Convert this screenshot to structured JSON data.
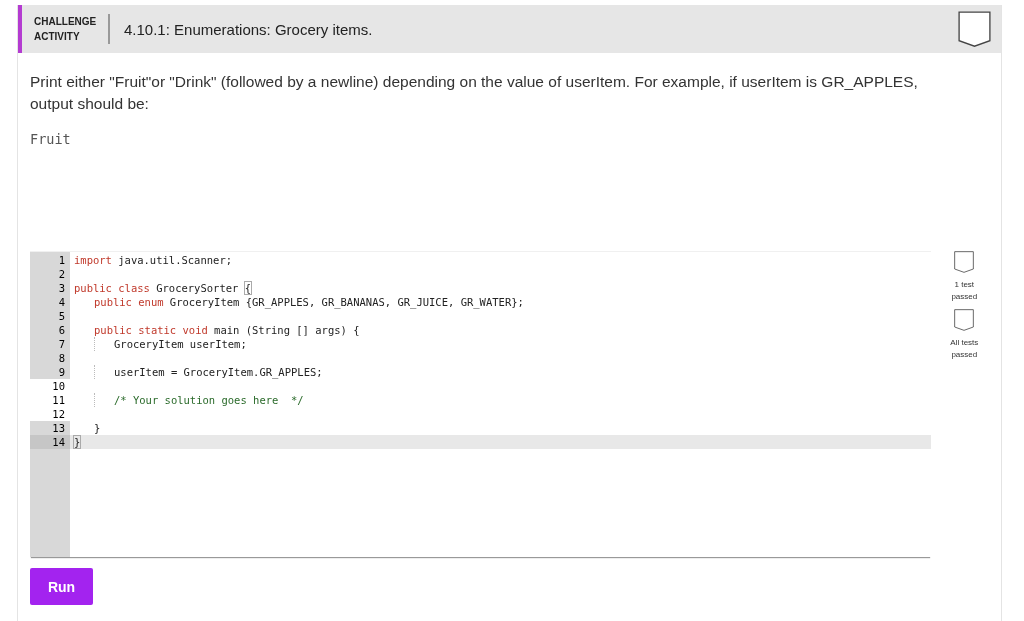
{
  "header": {
    "type_label": "CHALLENGE ACTIVITY",
    "title": "4.10.1: Enumerations: Grocery items.",
    "completed": false
  },
  "prompt": "Print either \"Fruit\"or \"Drink\" (followed by a newline) depending on the value of userItem. For example, if userItem is GR_APPLES, output should be:",
  "sample_output": "Fruit",
  "editor": {
    "lines": [
      {
        "number": "1",
        "kind": "top",
        "shaded": true,
        "current": false,
        "tokens": [
          {
            "kind": "keyword",
            "text": "import"
          },
          {
            "kind": "plain",
            "text": " java.util.Scanner;"
          }
        ]
      },
      {
        "number": "2",
        "kind": "blank",
        "shaded": true,
        "current": false
      },
      {
        "number": "3",
        "kind": "top",
        "shaded": true,
        "current": false,
        "tokens": [
          {
            "kind": "keyword",
            "text": "public class"
          },
          {
            "kind": "plain",
            "text": " GrocerySorter "
          },
          {
            "kind": "bracket",
            "text": "{"
          }
        ]
      },
      {
        "number": "4",
        "kind": "member",
        "shaded": true,
        "current": false,
        "tokens": [
          {
            "kind": "keyword",
            "text": "public enum"
          },
          {
            "kind": "plain",
            "text": " GroceryItem {GR_APPLES, GR_BANANAS, GR_JUICE, GR_WATER};"
          }
        ]
      },
      {
        "number": "5",
        "kind": "blank",
        "shaded": true,
        "current": false
      },
      {
        "number": "6",
        "kind": "member",
        "shaded": true,
        "current": false,
        "tokens": [
          {
            "kind": "keyword",
            "text": "public static void"
          },
          {
            "kind": "plain",
            "text": " main (String [] args) {"
          }
        ]
      },
      {
        "number": "7",
        "kind": "body",
        "shaded": true,
        "current": false,
        "tokens": [
          {
            "kind": "plain",
            "text": "GroceryItem userItem;"
          }
        ]
      },
      {
        "number": "8",
        "kind": "blank",
        "shaded": true,
        "current": false
      },
      {
        "number": "9",
        "kind": "body",
        "shaded": true,
        "current": false,
        "tokens": [
          {
            "kind": "plain",
            "text": "userItem = GroceryItem.GR_APPLES;"
          }
        ]
      },
      {
        "number": "10",
        "kind": "blank",
        "shaded": false,
        "current": false
      },
      {
        "number": "11",
        "kind": "body",
        "shaded": false,
        "current": false,
        "tokens": [
          {
            "kind": "comment",
            "text": "/* Your solution goes here  */"
          }
        ]
      },
      {
        "number": "12",
        "kind": "blank",
        "shaded": false,
        "current": false
      },
      {
        "number": "13",
        "kind": "member",
        "shaded": true,
        "current": false,
        "tokens": [
          {
            "kind": "plain",
            "text": "}"
          }
        ]
      },
      {
        "number": "14",
        "kind": "top",
        "shaded": true,
        "current": true,
        "tokens": [
          {
            "kind": "bracket",
            "text": "}"
          }
        ]
      }
    ]
  },
  "tests": [
    {
      "label": "1 test passed",
      "passed": false
    },
    {
      "label": "All tests passed",
      "passed": false
    }
  ],
  "run_button": "Run"
}
